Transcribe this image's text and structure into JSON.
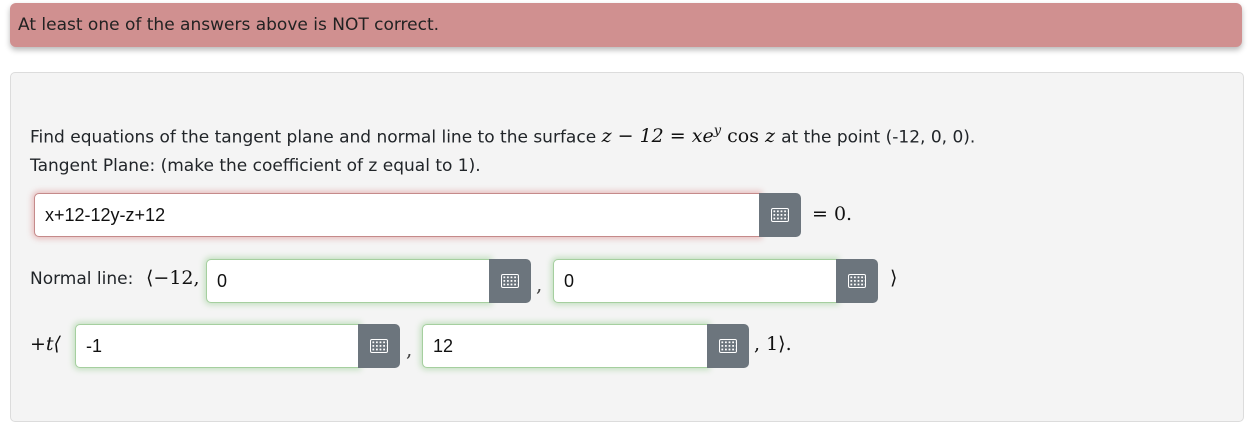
{
  "feedback": {
    "message": "At least one of the answers above is NOT correct."
  },
  "problem": {
    "prompt_prefix": "Find equations of the tangent plane and normal line to the surface",
    "surface_lhs": "z − 12 =",
    "surface_rhs_x": "xe",
    "surface_rhs_exp": "y",
    "surface_rhs_cos": " cos ",
    "surface_rhs_z": "z",
    "prompt_suffix": "at the point (-12, 0, 0).",
    "tangent_instruction": "Tangent Plane: (make the coefficient of z equal to 1).",
    "tangent_input_value": "x+12-12y-z+12",
    "tangent_suffix": "= 0.",
    "normal_label": "Normal line:",
    "normal_prefix": "⟨−12,",
    "normal_input_1": "0",
    "comma_1": ",",
    "normal_input_2": "0",
    "normal_suffix": "⟩",
    "param_prefix": "+t⟨",
    "param_input_1": "-1",
    "comma_2": ",",
    "param_input_2": "12",
    "param_suffix": ", 1⟩."
  },
  "icons": {
    "keyboard": "keyboard-icon"
  },
  "colors": {
    "alert_bg": "#d09090",
    "incorrect_glow": "#d25a5a",
    "correct_glow": "#6ebe64",
    "button_gray": "#6c757d"
  }
}
